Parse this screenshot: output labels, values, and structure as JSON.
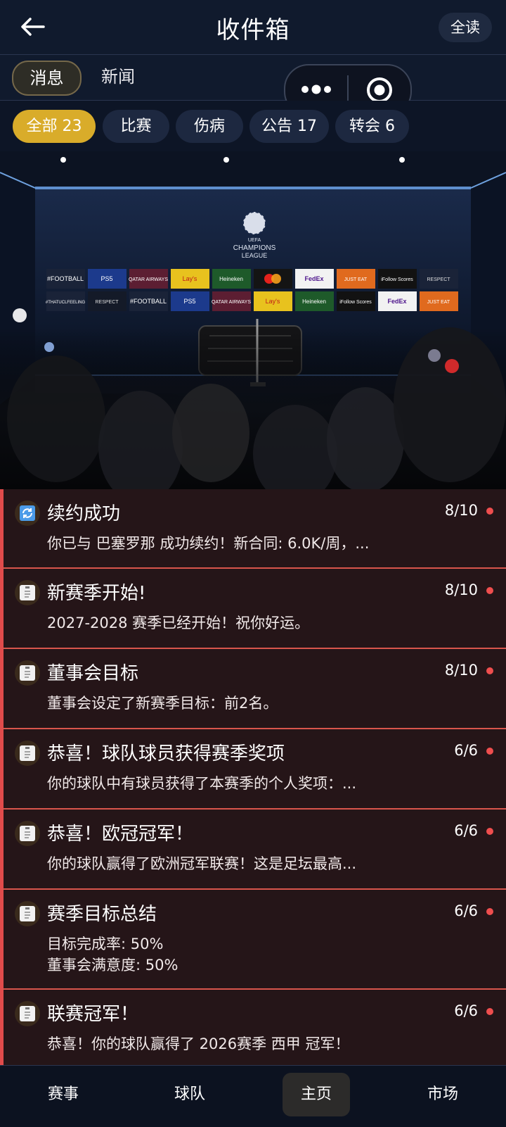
{
  "header": {
    "title": "收件箱",
    "read_all": "全读"
  },
  "tabs": [
    {
      "label": "消息",
      "active": true
    },
    {
      "label": "新闻",
      "active": false
    }
  ],
  "filters": [
    {
      "label": "全部 23",
      "active": true
    },
    {
      "label": "比赛",
      "active": false
    },
    {
      "label": "伤病",
      "active": false
    },
    {
      "label": "公告 17",
      "active": false
    },
    {
      "label": "转会 6",
      "active": false
    }
  ],
  "banner": {
    "logo_line1": "UEFA",
    "logo_line2": "CHAMPIONS",
    "logo_line3": "LEAGUE",
    "sponsors_row1": [
      "#FOOTBALL",
      "PS5",
      "QATAR AIRWAYS",
      "Lay's",
      "Heineken",
      "mastercard",
      "FedEx",
      "JUST EAT",
      "iFollow Scores",
      "RESPECT"
    ],
    "sponsors_row2": [
      "#THATUCLFEELING",
      "RESPECT",
      "#FOOTBALL",
      "PS5",
      "QATAR AIRWAYS",
      "Lay's",
      "Heineken",
      "iFollow Scores",
      "FedEx",
      "JUST EAT"
    ]
  },
  "messages": [
    {
      "icon": "sync-icon",
      "title": "续约成功",
      "date": "8/10",
      "body": [
        "你已与 巴塞罗那 成功续约！新合同: 6.0K/周，..."
      ]
    },
    {
      "icon": "clipboard-icon",
      "title": "新赛季开始!",
      "date": "8/10",
      "body": [
        "2027-2028 赛季已经开始！祝你好运。"
      ]
    },
    {
      "icon": "clipboard-icon",
      "title": "董事会目标",
      "date": "8/10",
      "body": [
        "董事会设定了新赛季目标：前2名。"
      ]
    },
    {
      "icon": "clipboard-icon",
      "title": "恭喜！球队球员获得赛季奖项",
      "date": "6/6",
      "body": [
        "你的球队中有球员获得了本赛季的个人奖项：..."
      ]
    },
    {
      "icon": "clipboard-icon",
      "title": "恭喜！欧冠冠军！",
      "date": "6/6",
      "body": [
        "你的球队赢得了欧洲冠军联赛！这是足坛最高..."
      ]
    },
    {
      "icon": "clipboard-icon",
      "title": "赛季目标总结",
      "date": "6/6",
      "body": [
        "目标完成率: 50%",
        "董事会满意度: 50%"
      ]
    },
    {
      "icon": "clipboard-icon",
      "title": "联赛冠军！",
      "date": "6/6",
      "body": [
        "恭喜！你的球队赢得了 2026赛季 西甲 冠军！"
      ]
    }
  ],
  "nav": [
    {
      "label": "赛事",
      "active": false
    },
    {
      "label": "球队",
      "active": false
    },
    {
      "label": "主页",
      "active": true
    },
    {
      "label": "市场",
      "active": false
    }
  ]
}
